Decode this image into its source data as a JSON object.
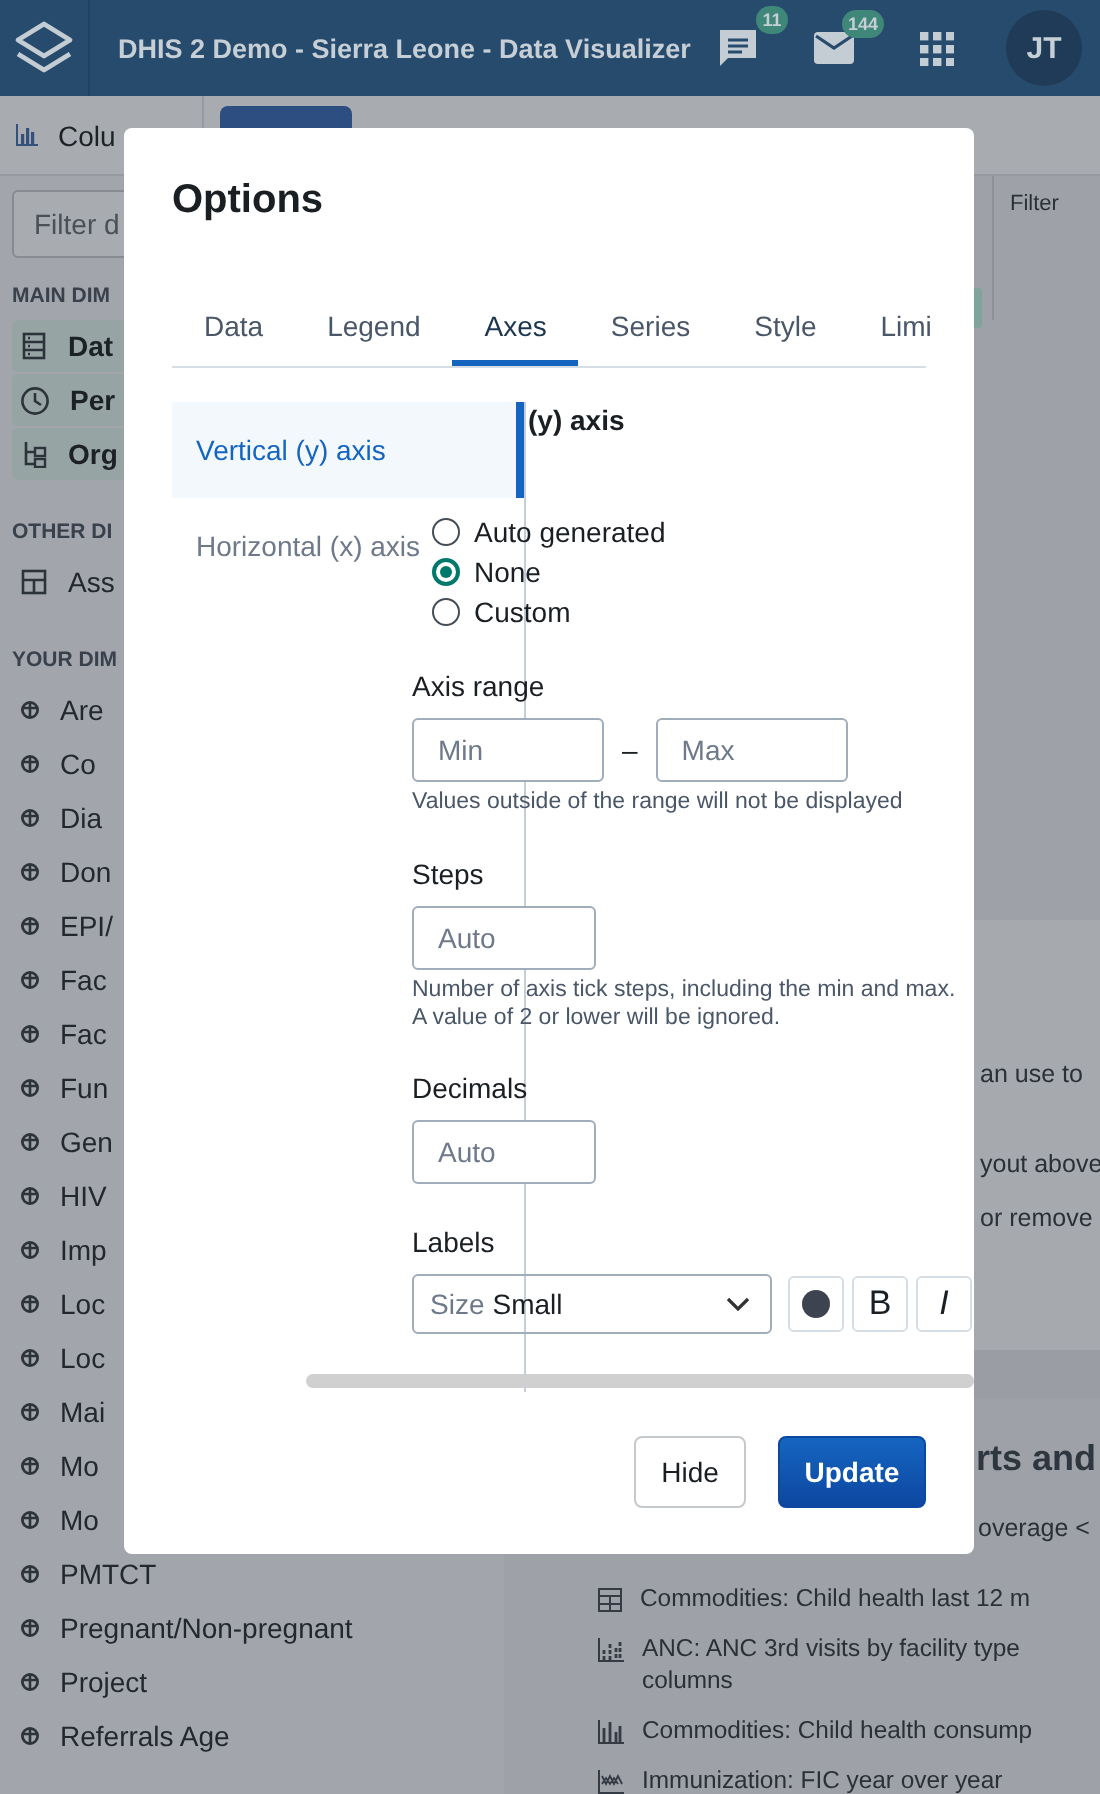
{
  "header": {
    "title": "DHIS 2 Demo - Sierra Leone - Data Visualizer",
    "badges": [
      {
        "kind": "chat",
        "count": "11"
      },
      {
        "kind": "mail",
        "count": "144"
      }
    ],
    "avatar": "JT"
  },
  "toolbar": {
    "visualization_type": "Colu"
  },
  "sidebar": {
    "filter": {
      "placeholder": "Filter d"
    },
    "sections": [
      {
        "title": "MAIN DIM",
        "items": [
          {
            "label": "Dat",
            "kind": "data",
            "selected": true
          },
          {
            "label": "Per",
            "kind": "period",
            "selected": true
          },
          {
            "label": "Org",
            "kind": "orgunit",
            "selected": true
          }
        ]
      },
      {
        "title": "OTHER DI",
        "items": [
          {
            "label": "Ass",
            "kind": "assigned",
            "selected": false
          }
        ]
      },
      {
        "title": "YOUR DIM",
        "items": [
          {
            "label": "Are",
            "kind": "dimension",
            "selected": false
          },
          {
            "label": "Co",
            "kind": "dimension",
            "selected": false
          },
          {
            "label": "Dia",
            "kind": "dimension",
            "selected": false
          },
          {
            "label": "Don",
            "kind": "dimension",
            "selected": false
          },
          {
            "label": "EPI/",
            "kind": "dimension",
            "selected": false
          },
          {
            "label": "Fac",
            "kind": "dimension",
            "selected": false
          },
          {
            "label": "Fac",
            "kind": "dimension",
            "selected": false
          },
          {
            "label": "Fun",
            "kind": "dimension",
            "selected": false
          },
          {
            "label": "Gen",
            "kind": "dimension",
            "selected": false
          },
          {
            "label": "HIV",
            "kind": "dimension",
            "selected": false
          },
          {
            "label": "Imp",
            "kind": "dimension",
            "selected": false
          },
          {
            "label": "Loc",
            "kind": "dimension",
            "selected": false
          },
          {
            "label": "Loc",
            "kind": "dimension",
            "selected": false
          },
          {
            "label": "Mai",
            "kind": "dimension",
            "selected": false
          },
          {
            "label": "Mo",
            "kind": "dimension",
            "selected": false
          },
          {
            "label": "Mo",
            "kind": "dimension",
            "selected": false
          },
          {
            "label": "PMTCT",
            "kind": "dimension",
            "selected": false
          },
          {
            "label": "Pregnant/Non-pregnant",
            "kind": "dimension",
            "selected": false
          },
          {
            "label": "Project",
            "kind": "dimension",
            "selected": false
          },
          {
            "label": "Referrals Age",
            "kind": "dimension",
            "selected": false
          }
        ]
      }
    ]
  },
  "layout": {
    "filter_label": "Filter"
  },
  "main": {
    "fragments": [
      "an use to",
      "yout above",
      "or remove"
    ],
    "heading": "rts and",
    "first_item_tail": "overage <",
    "items": [
      {
        "kind": "pivot",
        "lines": [
          "Commodities: Child health last 12 m"
        ]
      },
      {
        "kind": "stacked",
        "lines": [
          "ANC: ANC 3rd visits by facility type",
          "columns"
        ]
      },
      {
        "kind": "column",
        "lines": [
          "Commodities: Child health consump"
        ]
      },
      {
        "kind": "yoy",
        "lines": [
          "Immunization: FIC year over year"
        ]
      }
    ]
  },
  "options_modal": {
    "title": "Options",
    "tabs": [
      {
        "label": "Data",
        "selected": false
      },
      {
        "label": "Legend",
        "selected": false
      },
      {
        "label": "Axes",
        "selected": true
      },
      {
        "label": "Series",
        "selected": false
      },
      {
        "label": "Style",
        "selected": false
      },
      {
        "label": "Limi",
        "selected": false
      }
    ],
    "nav": [
      {
        "label": "Vertical (y) axis",
        "selected": true
      },
      {
        "label": "Horizontal (x) axis",
        "selected": false
      }
    ],
    "section_heading": "(y) axis",
    "title_options": [
      {
        "label": "Auto generated",
        "selected": false
      },
      {
        "label": "None",
        "selected": true
      },
      {
        "label": "Custom",
        "selected": false
      }
    ],
    "axis_range": {
      "label": "Axis range",
      "min": {
        "placeholder": "Min"
      },
      "separator": "–",
      "max": {
        "placeholder": "Max"
      },
      "help": "Values outside of the range will not be displayed"
    },
    "steps": {
      "label": "Steps",
      "placeholder": "Auto",
      "help": "Number of axis tick steps, including the min and max. A value of 2 or lower will be ignored."
    },
    "decimals": {
      "label": "Decimals",
      "placeholder": "Auto"
    },
    "labels": {
      "label": "Labels",
      "size_prefix": "Size",
      "size_value": "Small",
      "color": "#3d4450",
      "bold_label": "B",
      "italic_label": "I",
      "bold": false,
      "italic": false
    },
    "buttons": [
      {
        "label": "Hide",
        "kind": "secondary"
      },
      {
        "label": "Update",
        "kind": "primary"
      }
    ]
  }
}
